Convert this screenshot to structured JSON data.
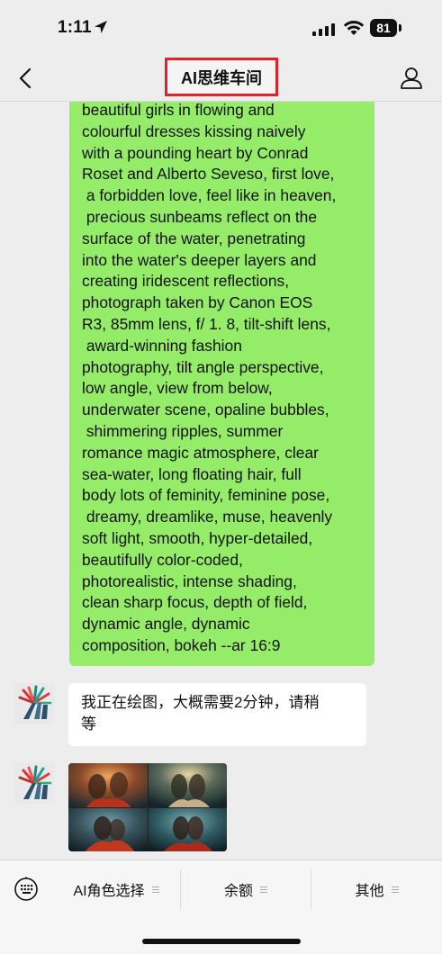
{
  "status_bar": {
    "time": "1:11",
    "battery": "81"
  },
  "nav": {
    "title": "AI思维车间"
  },
  "messages": {
    "prompt_text": "beautiful girls in flowing and\ncolourful dresses kissing naively\nwith a pounding heart by Conrad\nRoset and Alberto Seveso, first love,\n a forbidden love, feel like in heaven,\n precious sunbeams reflect on the\nsurface of the water, penetrating\ninto the water's deeper layers and\ncreating iridescent reflections,\nphotograph taken by Canon EOS\nR3, 85mm lens, f/ 1. 8, tilt-shift lens,\n award-winning fashion\nphotography, tilt angle perspective,\nlow angle, view from below,\nunderwater scene, opaline bubbles,\n shimmering ripples, summer\nromance magic atmosphere, clear\nsea-water, long floating hair, full\nbody lots of feminity, feminine pose,\n dreamy, dreamlike, muse, heavenly\nsoft light, smooth, hyper-detailed,\nbeautifully color-coded,\nphotorealistic, intense shading,\nclean sharp focus, depth of field,\ndynamic angle, dynamic\ncomposition, bokeh --ar 16:9",
    "bot_reply": "我正在绘图，大概需要2分钟，请稍\n等"
  },
  "bottom_menu": {
    "items": [
      {
        "label": "AI角色选择"
      },
      {
        "label": "余额"
      },
      {
        "label": "其他"
      }
    ]
  },
  "colors": {
    "user_bubble": "#95ec69",
    "highlight_box": "#e0232b"
  },
  "icons": [
    "location-arrow-icon",
    "cellular-signal-icon",
    "wifi-icon",
    "battery-icon",
    "back-chevron-icon",
    "person-icon",
    "keyboard-icon",
    "menu-lines-icon",
    "bot-logo-icon"
  ]
}
